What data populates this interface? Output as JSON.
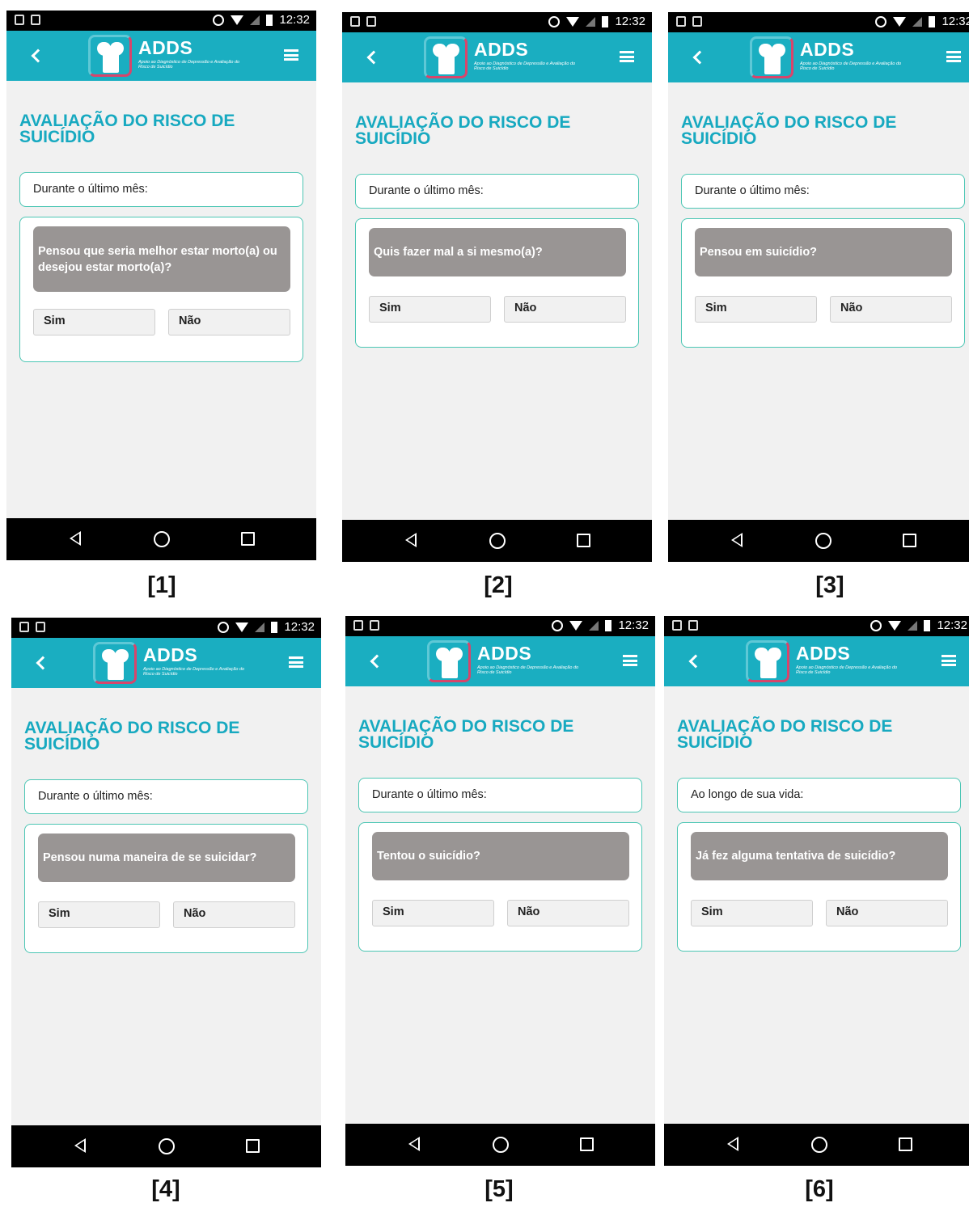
{
  "status_time": "12:32",
  "app": {
    "logo_title": "ADDS",
    "logo_subtitle": "Apoio ao Diagnóstico de Depressão e Avaliação do Risco de Suicídio"
  },
  "page_title": "AVALIAÇÃO DO RISCO DE SUICÍDIO",
  "answers": {
    "yes": "Sim",
    "no": "Não"
  },
  "screens": [
    {
      "caption": "[1]",
      "context": "Durante o último mês:",
      "question": "Pensou que seria melhor estar morto(a) ou desejou estar morto(a)?"
    },
    {
      "caption": "[2]",
      "context": "Durante o último mês:",
      "question": "Quis fazer mal a si mesmo(a)?"
    },
    {
      "caption": "[3]",
      "context": "Durante o último mês:",
      "question": "Pensou em suicídio?"
    },
    {
      "caption": "[4]",
      "context": "Durante o último mês:",
      "question": "Pensou numa maneira de se suicidar?"
    },
    {
      "caption": "[5]",
      "context": "Durante o último mês:",
      "question": "Tentou o suicídio?"
    },
    {
      "caption": "[6]",
      "context": "Ao longo de sua vida:",
      "question": "Já fez alguma tentativa de suicídio?"
    }
  ],
  "colors": {
    "app_bar": "#1aaec1",
    "title": "#17a9c0",
    "card_border": "#4cc6b4",
    "question_bg": "#999594"
  }
}
